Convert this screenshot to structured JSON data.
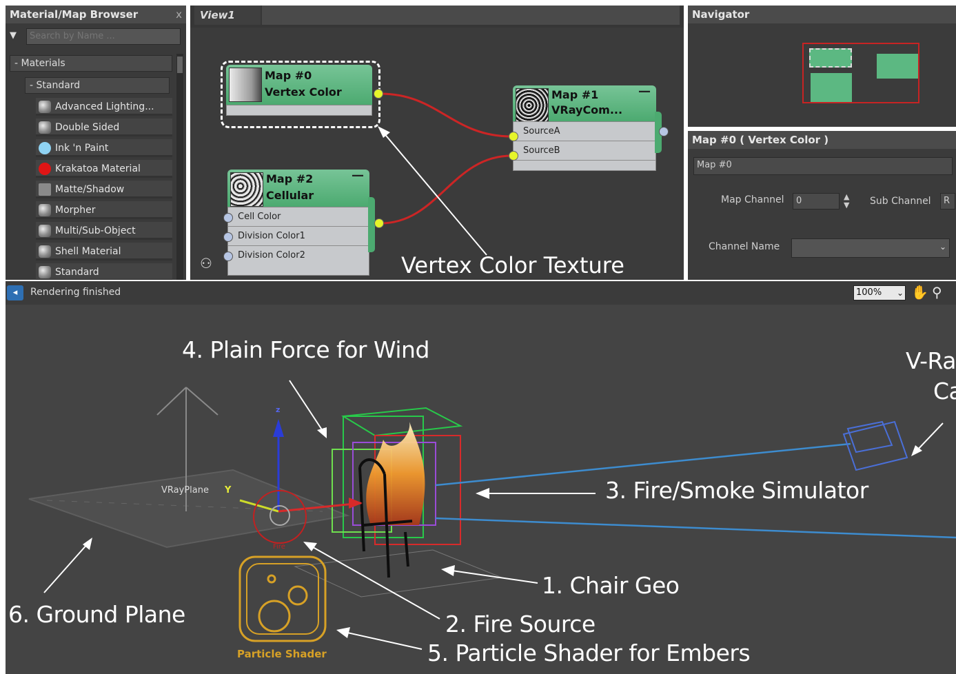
{
  "browser": {
    "title": "Material/Map Browser",
    "close": "x",
    "search_placeholder": "Search by Name ...",
    "category": "- Materials",
    "subcategory": "- Standard",
    "items": [
      {
        "label": "Advanced Lighting...",
        "icon": "sphere-icon"
      },
      {
        "label": "Double Sided",
        "icon": "sphere-icon"
      },
      {
        "label": "Ink 'n Paint",
        "icon": "ink-paint-icon",
        "color": "#8fd3f3"
      },
      {
        "label": "Krakatoa Material",
        "icon": "krakatoa-icon",
        "color": "#e01515"
      },
      {
        "label": "Matte/Shadow",
        "icon": "matte-icon"
      },
      {
        "label": "Morpher",
        "icon": "sphere-icon"
      },
      {
        "label": "Multi/Sub-Object",
        "icon": "sphere-icon"
      },
      {
        "label": "Shell Material",
        "icon": "sphere-icon"
      },
      {
        "label": "Standard",
        "icon": "sphere-icon"
      }
    ]
  },
  "view": {
    "tab": "View1",
    "annotation": "Vertex Color Texture",
    "nodes": {
      "map0": {
        "title1": "Map #0",
        "title2": "Vertex Color"
      },
      "map1": {
        "title1": "Map #1",
        "title2": "VRayCom...",
        "slots": [
          "SourceA",
          "SourceB"
        ],
        "minimize": "—"
      },
      "map2": {
        "title1": "Map #2",
        "title2": "Cellular",
        "slots": [
          "Cell Color",
          "Division Color1",
          "Division Color2"
        ],
        "minimize": "—"
      }
    },
    "accent": "#5cb882"
  },
  "navigator": {
    "title": "Navigator"
  },
  "params": {
    "title": "Map #0  ( Vertex Color )",
    "name_value": "Map #0",
    "map_channel_label": "Map Channel",
    "map_channel_value": "0",
    "sub_channel_label": "Sub Channel",
    "sub_channel_value": "R",
    "channel_name_label": "Channel Name"
  },
  "status": {
    "text": "Rendering finished",
    "zoom": "100%"
  },
  "viewport": {
    "labels": {
      "vray_plane": "VRayPlane",
      "fire": "Fire",
      "particle_shader": "Particle Shader",
      "axis_y": "Y",
      "axis_z": "z"
    },
    "callouts": {
      "wind": "4. Plain Force for Wind",
      "camera_line1": "V-Ra",
      "camera_line2": "Ca",
      "simulator": "3. Fire/Smoke Simulator",
      "chair": "1. Chair Geo",
      "ground": "6. Ground Plane",
      "fire_source": "2. Fire Source",
      "embers": "5. Particle Shader for Embers"
    }
  }
}
